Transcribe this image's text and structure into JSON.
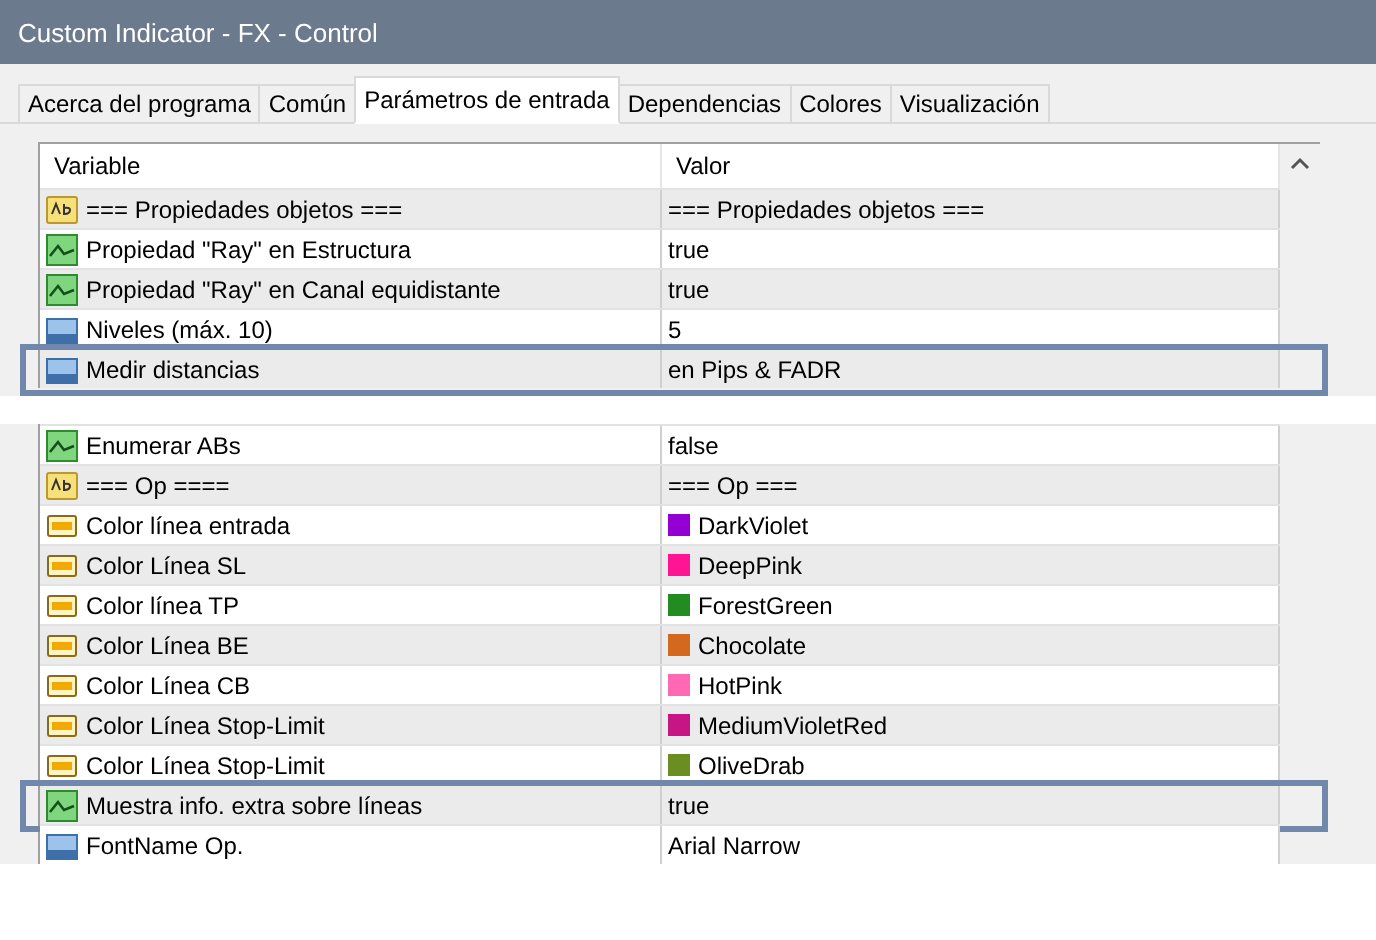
{
  "window": {
    "title": "Custom Indicator - FX - Control"
  },
  "tabs": [
    {
      "label": "Acerca del programa",
      "selected": false
    },
    {
      "label": "Común",
      "selected": false
    },
    {
      "label": "Parámetros de entrada",
      "selected": true
    },
    {
      "label": "Dependencias",
      "selected": false
    },
    {
      "label": "Colores",
      "selected": false
    },
    {
      "label": "Visualización",
      "selected": false
    }
  ],
  "table": {
    "columns": [
      "Variable",
      "Valor"
    ],
    "rows": [
      {
        "kind": "text",
        "variable": "=== Propiedades objetos ===",
        "value": "=== Propiedades objetos ===",
        "highlighted": false
      },
      {
        "kind": "bool",
        "variable": "Propiedad \"Ray\" en Estructura",
        "value": "true",
        "highlighted": false
      },
      {
        "kind": "bool",
        "variable": "Propiedad \"Ray\" en Canal equidistante",
        "value": "true",
        "highlighted": false
      },
      {
        "kind": "number",
        "variable": "Niveles (máx. 10)",
        "value": "5",
        "highlighted": false
      },
      {
        "kind": "number",
        "variable": "Medir distancias",
        "value": "en Pips & FADR",
        "highlighted": true
      }
    ]
  },
  "table_excerpt": {
    "rows": [
      {
        "kind": "bool",
        "variable": "Enumerar ABs",
        "value": "false",
        "highlighted": false
      },
      {
        "kind": "text",
        "variable": "=== Op ====",
        "value": "=== Op ===",
        "highlighted": false
      },
      {
        "kind": "color",
        "variable": "Color línea entrada",
        "value": "DarkViolet",
        "color": "#9400d3",
        "highlighted": false
      },
      {
        "kind": "color",
        "variable": "Color Línea SL",
        "value": "DeepPink",
        "color": "#ff1493",
        "highlighted": false
      },
      {
        "kind": "color",
        "variable": "Color línea TP",
        "value": "ForestGreen",
        "color": "#228b22",
        "highlighted": false
      },
      {
        "kind": "color",
        "variable": "Color Línea BE",
        "value": "Chocolate",
        "color": "#d2691e",
        "highlighted": false
      },
      {
        "kind": "color",
        "variable": "Color Línea CB",
        "value": "HotPink",
        "color": "#ff69b4",
        "highlighted": false
      },
      {
        "kind": "color",
        "variable": "Color Línea Stop-Limit",
        "value": "MediumVioletRed",
        "color": "#c71585",
        "highlighted": false
      },
      {
        "kind": "color",
        "variable": "Color Línea Stop-Limit",
        "value": "OliveDrab",
        "color": "#6b8e23",
        "highlighted": false
      },
      {
        "kind": "bool",
        "variable": "Muestra info. extra sobre líneas",
        "value": "true",
        "highlighted": true
      },
      {
        "kind": "number",
        "variable": "FontName Op.",
        "value": "Arial Narrow",
        "highlighted": false
      }
    ]
  }
}
